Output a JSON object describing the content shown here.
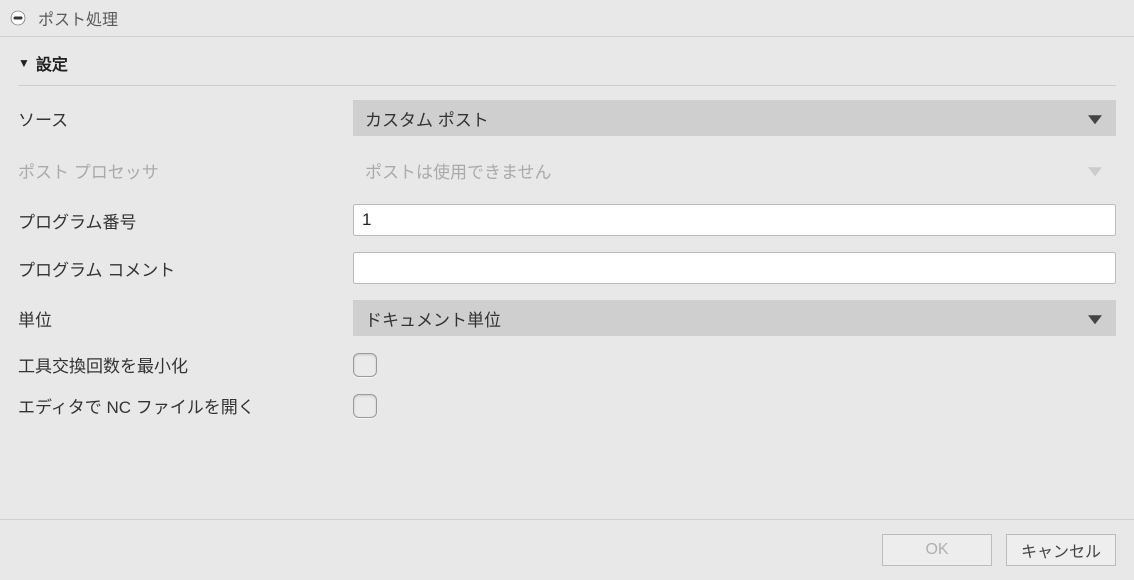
{
  "titlebar": {
    "title": "ポスト処理"
  },
  "section": {
    "header": "設定",
    "source": {
      "label": "ソース",
      "value": "カスタム ポスト"
    },
    "postprocessor": {
      "label": "ポスト プロセッサ",
      "value": "ポストは使用できません"
    },
    "program_number": {
      "label": "プログラム番号",
      "value": "1"
    },
    "program_comment": {
      "label": "プログラム コメント",
      "value": ""
    },
    "unit": {
      "label": "単位",
      "value": "ドキュメント単位"
    },
    "minimize_tool_changes": {
      "label": "工具交換回数を最小化"
    },
    "open_nc_in_editor": {
      "label": "エディタで NC ファイルを開く"
    }
  },
  "buttons": {
    "ok": "OK",
    "cancel": "キャンセル"
  }
}
